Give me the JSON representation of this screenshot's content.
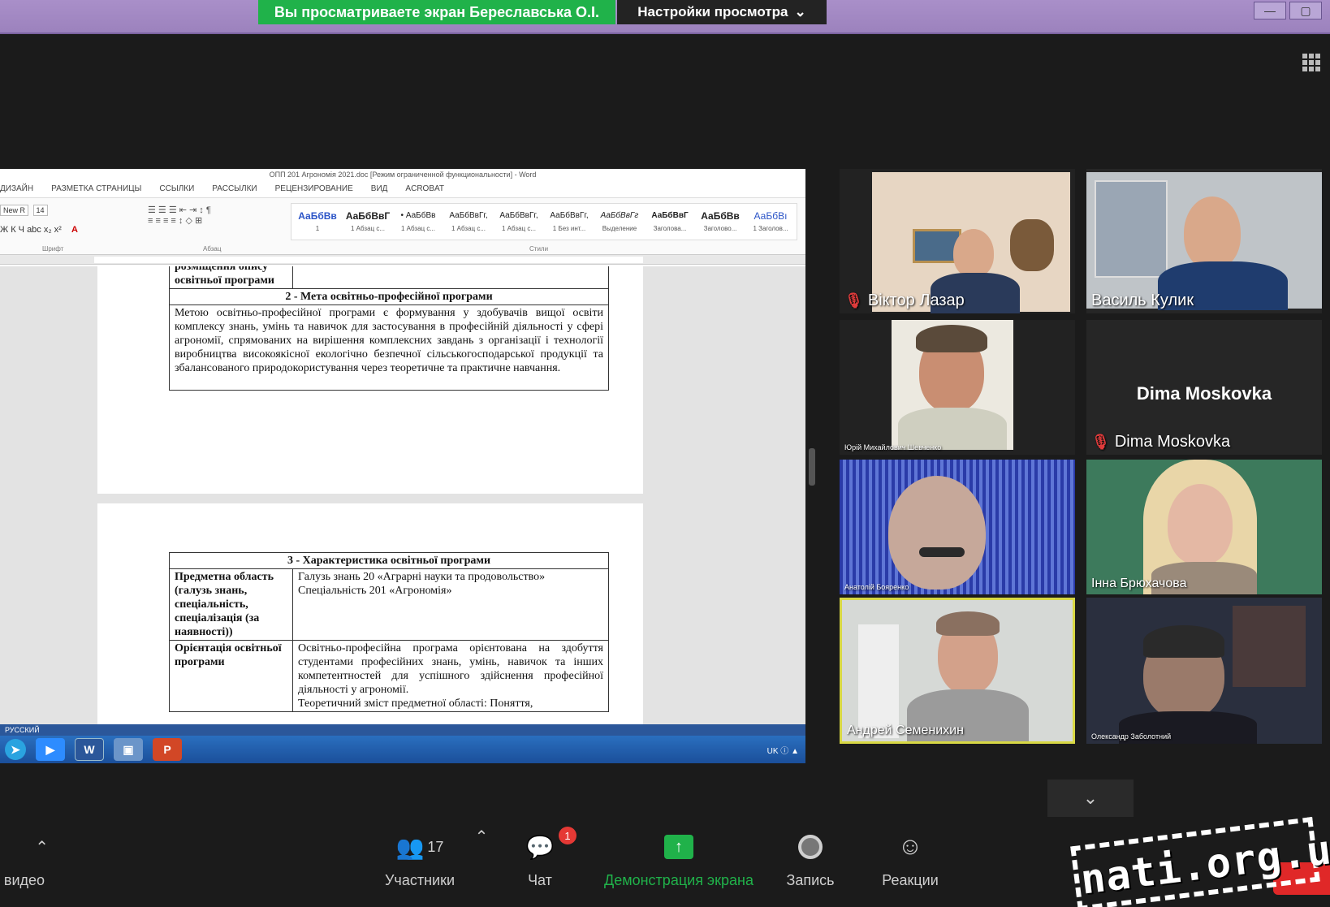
{
  "topbar": {
    "viewing_banner": "Вы просматриваете экран Береславська О.І.",
    "view_options": "Настройки просмотра"
  },
  "word": {
    "title": "ОПП 201 Агрономія 2021.doc [Режим ограниченной функциональности] - Word",
    "tabs": [
      "ДИЗАЙН",
      "РАЗМЕТКА СТРАНИЦЫ",
      "ССЫЛКИ",
      "РАССЫЛКИ",
      "РЕЦЕНЗИРОВАНИЕ",
      "ВИД",
      "ACROBAT"
    ],
    "font_name": "New R",
    "font_size": "14",
    "group_labels": [
      "Шрифт",
      "Абзац",
      "Стили"
    ],
    "styles": [
      {
        "preview": "АаБбВв",
        "name": "1"
      },
      {
        "preview": "АаБбВвГ",
        "name": "1 Абзац с..."
      },
      {
        "preview": "• АаБбВв",
        "name": "1 Абзац с..."
      },
      {
        "preview": "АаБбВвГг,",
        "name": "1 Абзац с..."
      },
      {
        "preview": "АаБбВвГг,",
        "name": "1 Абзац с..."
      },
      {
        "preview": "АаБбВвГг,",
        "name": "1 Без инт..."
      },
      {
        "preview": "АаБбВвГг",
        "name": "Выделение"
      },
      {
        "preview": "АаБбВвГ",
        "name": "Заголова..."
      },
      {
        "preview": "АаБбВв",
        "name": "Заголово..."
      },
      {
        "preview": "АаБбВı",
        "name": "1 Заголов..."
      }
    ],
    "status_lang": "РУССКИЙ",
    "tray": "UK"
  },
  "doc": {
    "placement_label": "розміщення опису освітньої програми",
    "section2_title": "2 - Мета освітньо-професійної програми",
    "section2_text": "Метою освітньо-професійної програми є формування у здобувачів вищої освіти комплексу знань, умінь та навичок для застосування в професійній діяльності у сфері агрономії, спрямованих на вирішення комплексних завдань з організації і технології виробництва високоякісної екологічно безпечної сільськогосподарської продукції та збалансованого природокористування через теоретичне та практичне навчання.",
    "section3_title": "3 - Характеристика освітньої програми",
    "subject_label": "Предметна область (галузь знань, спеціальність, спеціалізація (за наявності))",
    "subject_value_1": "Галузь знань 20 «Аграрні науки та продовольство»",
    "subject_value_2": "Спеціальність 201 «Агрономія»",
    "orientation_label": "Орієнтація освітньої програми",
    "orientation_value": "Освітньо-професійна програма орієнтована на здобуття студентами професійних знань, умінь, навичок та інших компетентностей для успішного здійснення професійної діяльності у агрономії.",
    "theory_value": "Теоретичний зміст предметної області: Поняття,"
  },
  "participants": [
    {
      "name": "Віктор Лазар",
      "muted": true
    },
    {
      "name": "Василь Кулик",
      "muted": false
    },
    {
      "name": "Юрій Михайлович Шевченко",
      "muted": true
    },
    {
      "name": "Dima Moskovka",
      "display": "Dima Moskovka",
      "muted": true
    },
    {
      "name": "Анатолій Бояренко",
      "muted": false
    },
    {
      "name": "Інна Брюхачова",
      "muted": false
    },
    {
      "name": "Андрей Семенихин",
      "muted": false
    },
    {
      "name": "Олександр Заболотний",
      "muted": false
    }
  ],
  "toolbar": {
    "video_label": "видео",
    "participants_label": "Участники",
    "participants_count": "17",
    "chat_label": "Чат",
    "chat_badge": "1",
    "share_label": "Демонстрация экрана",
    "record_label": "Запись",
    "reactions_label": "Реакции"
  },
  "watermark": "nati.org.ua"
}
